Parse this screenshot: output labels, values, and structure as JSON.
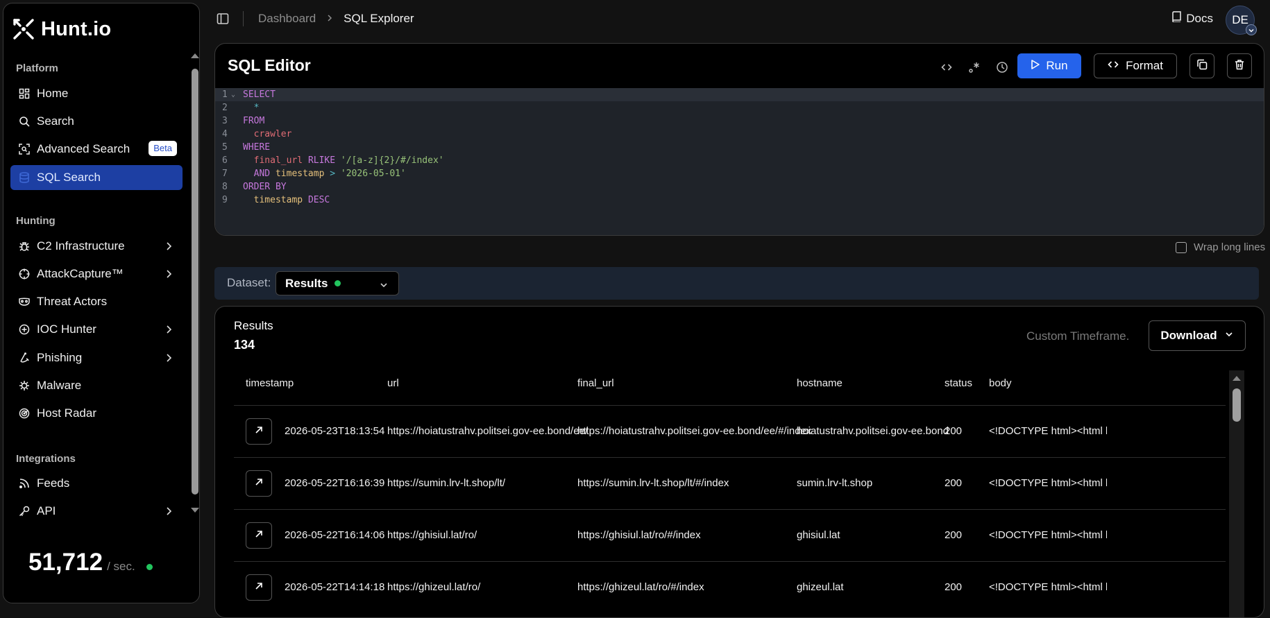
{
  "app": {
    "name": "Hunt.io"
  },
  "sidebar": {
    "sections": [
      {
        "title": "Platform"
      },
      {
        "title": "Hunting"
      },
      {
        "title": "Integrations"
      }
    ],
    "items": [
      {
        "label": "Home",
        "icon": "dashboard-icon"
      },
      {
        "label": "Search",
        "icon": "search-icon"
      },
      {
        "label": "Advanced Search",
        "icon": "scan-search-icon",
        "badge": "Beta"
      },
      {
        "label": "SQL Search",
        "icon": "database-icon",
        "active": true
      },
      {
        "label": "C2 Infrastructure",
        "icon": "bug-icon"
      },
      {
        "label": "AttackCapture™",
        "icon": "crosshair-icon"
      },
      {
        "label": "Threat Actors",
        "icon": "mask-icon"
      },
      {
        "label": "IOC Hunter",
        "icon": "plus-circle-icon"
      },
      {
        "label": "Phishing",
        "icon": "fishing-hook-icon"
      },
      {
        "label": "Malware",
        "icon": "virus-icon"
      },
      {
        "label": "Host Radar",
        "icon": "radar-icon"
      },
      {
        "label": "Feeds",
        "icon": "rss-icon"
      },
      {
        "label": "API",
        "icon": "key-icon"
      }
    ],
    "counter": {
      "value": "51,712",
      "unit": "/ sec."
    }
  },
  "topbar": {
    "breadcrumb": [
      "Dashboard",
      "SQL Explorer"
    ],
    "docs_label": "Docs",
    "avatar_initials": "DE"
  },
  "editor": {
    "title": "SQL Editor",
    "run_label": "Run",
    "format_label": "Format",
    "lines": [
      {
        "n": "1",
        "tokens": [
          [
            "kw",
            "SELECT"
          ]
        ]
      },
      {
        "n": "2",
        "tokens": [
          [
            "pl",
            "  "
          ],
          [
            "op",
            "*"
          ]
        ]
      },
      {
        "n": "3",
        "tokens": [
          [
            "kw",
            "FROM"
          ]
        ]
      },
      {
        "n": "4",
        "tokens": [
          [
            "pl",
            "  "
          ],
          [
            "tb",
            "crawler"
          ]
        ]
      },
      {
        "n": "5",
        "tokens": [
          [
            "kw",
            "WHERE"
          ]
        ]
      },
      {
        "n": "6",
        "tokens": [
          [
            "pl",
            "  "
          ],
          [
            "tb",
            "final_url"
          ],
          [
            "pl",
            " "
          ],
          [
            "kw",
            "RLIKE"
          ],
          [
            "pl",
            " "
          ],
          [
            "str",
            "'/[a-z]{2}/#/index'"
          ]
        ]
      },
      {
        "n": "7",
        "tokens": [
          [
            "pl",
            "  "
          ],
          [
            "kw",
            "AND"
          ],
          [
            "pl",
            " "
          ],
          [
            "fn",
            "timestamp"
          ],
          [
            "pl",
            " "
          ],
          [
            "op",
            ">"
          ],
          [
            "pl",
            " "
          ],
          [
            "str",
            "'2026-05-01'"
          ]
        ]
      },
      {
        "n": "8",
        "tokens": [
          [
            "kw",
            "ORDER BY"
          ]
        ]
      },
      {
        "n": "9",
        "tokens": [
          [
            "pl",
            "  "
          ],
          [
            "fn",
            "timestamp"
          ],
          [
            "pl",
            " "
          ],
          [
            "kw",
            "DESC"
          ]
        ]
      }
    ],
    "wrap_label": "Wrap long lines"
  },
  "dataset": {
    "label": "Dataset:",
    "selected": "Results"
  },
  "results": {
    "label": "Results",
    "count": "134",
    "timeframe": "Custom Timeframe.",
    "download_label": "Download",
    "columns": [
      "timestamp",
      "url",
      "final_url",
      "hostname",
      "status",
      "body"
    ],
    "rows": [
      {
        "timestamp": "2026-05-23T18:13:54",
        "url": "https://hoiatustrahv.politsei.gov-ee.bond/ee/",
        "final_url": "https://hoiatustrahv.politsei.gov-ee.bond/ee/#/index",
        "hostname": "hoiatustrahv.politsei.gov-ee.bond",
        "status": "200",
        "body": "<!DOCTYPE html><html la"
      },
      {
        "timestamp": "2026-05-22T16:16:39",
        "url": "https://sumin.lrv-lt.shop/lt/",
        "final_url": "https://sumin.lrv-lt.shop/lt/#/index",
        "hostname": "sumin.lrv-lt.shop",
        "status": "200",
        "body": "<!DOCTYPE html><html la"
      },
      {
        "timestamp": "2026-05-22T16:14:06",
        "url": "https://ghisiul.lat/ro/",
        "final_url": "https://ghisiul.lat/ro/#/index",
        "hostname": "ghisiul.lat",
        "status": "200",
        "body": "<!DOCTYPE html><html la"
      },
      {
        "timestamp": "2026-05-22T14:14:18",
        "url": "https://ghizeul.lat/ro/",
        "final_url": "https://ghizeul.lat/ro/#/index",
        "hostname": "ghizeul.lat",
        "status": "200",
        "body": "<!DOCTYPE html><html la"
      }
    ]
  },
  "colors": {
    "accent": "#2563eb",
    "active_nav": "#1d3fa3",
    "online": "#22c55e"
  }
}
